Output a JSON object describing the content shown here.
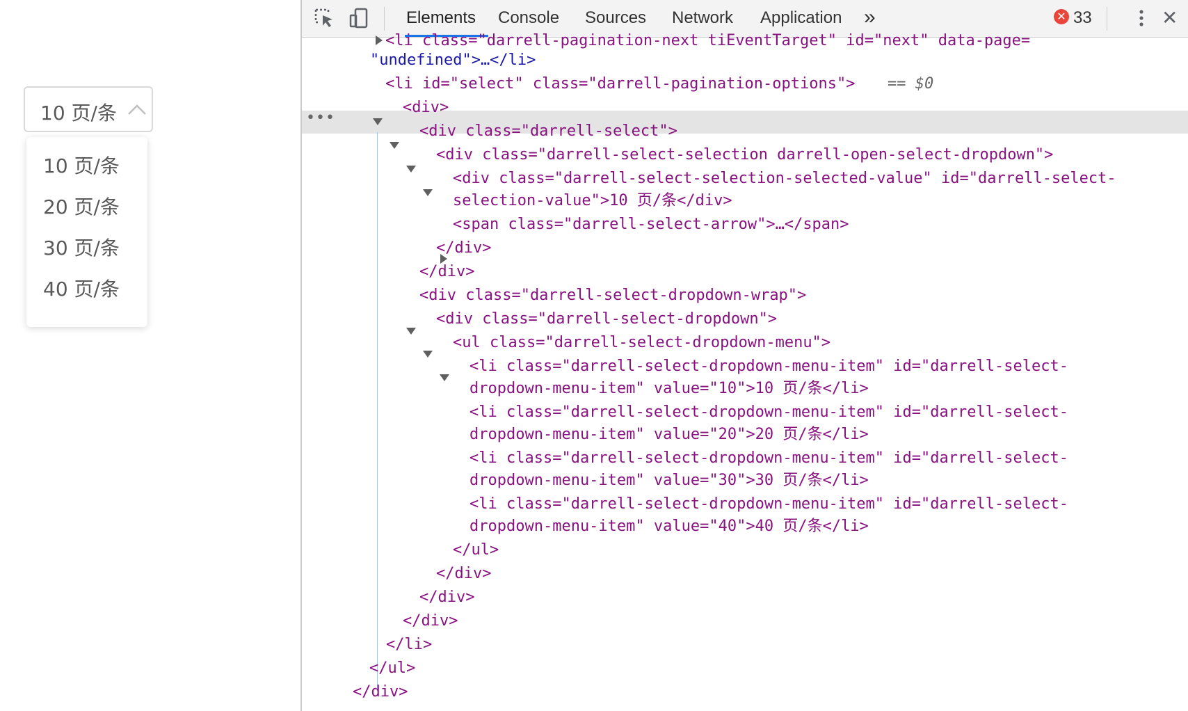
{
  "page": {
    "select_value": "10 页/条",
    "dropdown_options": [
      "10 页/条",
      "20 页/条",
      "30 页/条",
      "40 页/条"
    ]
  },
  "devtools": {
    "tabs": [
      "Elements",
      "Console",
      "Sources",
      "Network",
      "Application"
    ],
    "active_tab": "Elements",
    "more_tabs_glyph": "»",
    "error_count": "33",
    "error_glyph": "✕",
    "close_glyph": "✕",
    "selected_marker": "== $0",
    "gutter_dots": "•••",
    "lines": [
      "<li class=\"darrell-pagination-next tiEventTarget\" id=\"next\" data-page=",
      "\"undefined\">…</li>",
      "<li id=\"select\" class=\"darrell-pagination-options\">",
      "<div>",
      "<div class=\"darrell-select\">",
      "<div class=\"darrell-select-selection darrell-open-select-dropdown\">",
      "<div class=\"darrell-select-selection-selected-value\" id=\"darrell-select-",
      "selection-value\">10 页/条</div>",
      "<span class=\"darrell-select-arrow\">…</span>",
      "</div>",
      "</div>",
      "<div class=\"darrell-select-dropdown-wrap\">",
      "<div class=\"darrell-select-dropdown\">",
      "<ul class=\"darrell-select-dropdown-menu\">",
      "<li class=\"darrell-select-dropdown-menu-item\" id=\"darrell-select-",
      "dropdown-menu-item\" value=\"10\">10 页/条</li>",
      "<li class=\"darrell-select-dropdown-menu-item\" id=\"darrell-select-",
      "dropdown-menu-item\" value=\"20\">20 页/条</li>",
      "<li class=\"darrell-select-dropdown-menu-item\" id=\"darrell-select-",
      "dropdown-menu-item\" value=\"30\">30 页/条</li>",
      "<li class=\"darrell-select-dropdown-menu-item\" id=\"darrell-select-",
      "dropdown-menu-item\" value=\"40\">40 页/条</li>",
      "</ul>",
      "</div>",
      "</div>",
      "</div>",
      "</li>",
      "</ul>",
      "</div>"
    ]
  },
  "colors": {
    "tag": "#881280",
    "attribute_name": "#994500",
    "attribute_value": "#1a1aa6",
    "selected_row": "#e4e4e4",
    "active_tab_underline": "#1a73e8",
    "error_badge": "#e8463b"
  },
  "icons": [
    "inspect-element-icon",
    "device-toolbar-icon",
    "more-tabs-icon",
    "error-icon",
    "kebab-menu-icon",
    "close-icon",
    "select-arrow-up-icon"
  ]
}
